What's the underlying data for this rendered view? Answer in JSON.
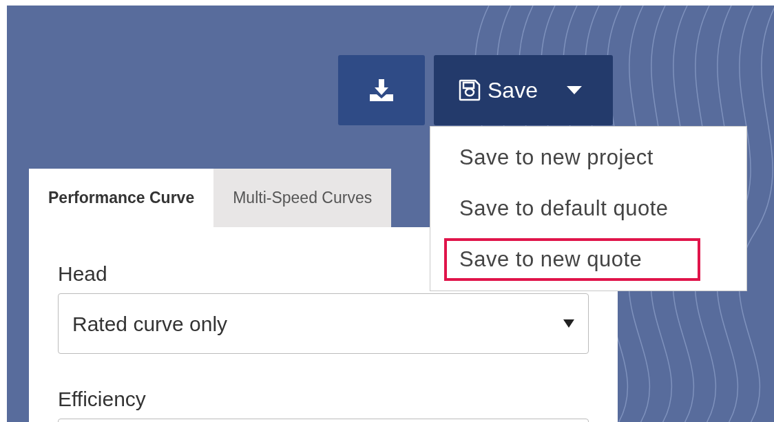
{
  "save_button": {
    "label": "Save",
    "expanded": true
  },
  "save_menu": {
    "items": [
      {
        "label": "Save to new project",
        "highlighted": false
      },
      {
        "label": "Save to default quote",
        "highlighted": false
      },
      {
        "label": "Save to new quote",
        "highlighted": true
      }
    ]
  },
  "tabs": [
    {
      "label": "Performance Curve",
      "selected": true
    },
    {
      "label": "Multi-Speed Curves",
      "selected": false
    }
  ],
  "fields": [
    {
      "label": "Head",
      "value": "Rated curve only"
    },
    {
      "label": "Efficiency"
    }
  ]
}
